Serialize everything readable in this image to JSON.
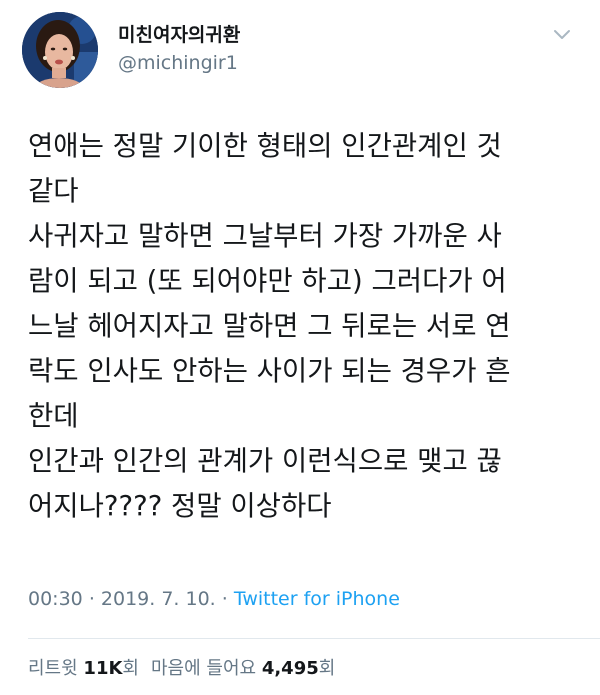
{
  "user": {
    "display_name": "미친여자의귀환",
    "handle": "@michingir1",
    "avatar_icon": "profile-photo"
  },
  "tweet": {
    "lines": [
      "연애는 정말 기이한 형태의 인간관계인 것",
      "같다",
      "사귀자고 말하면 그날부터 가장 가까운 사",
      "람이 되고 (또 되어야만 하고) 그러다가 어",
      "느날 헤어지자고 말하면 그 뒤로는 서로 연",
      "락도 인사도 안하는 사이가 되는 경우가 흔",
      "한데",
      "인간과 인간의 관계가 이런식으로 맺고 끊",
      "어지나???? 정말 이상하다"
    ]
  },
  "meta": {
    "time": "00:30",
    "separator": "·",
    "date": "2019. 7. 10.",
    "source": "Twitter for iPhone"
  },
  "stats": {
    "retweets_label": "리트윗",
    "retweets_count": "11K",
    "retweets_suffix": "회",
    "likes_label": "마음에 들어요",
    "likes_count": "4,495",
    "likes_suffix": "회"
  },
  "colors": {
    "text": "#14171a",
    "secondary": "#657786",
    "link": "#1da1f2",
    "divider": "#e1e8ed"
  },
  "icons": {
    "menu": "chevron-down-icon"
  }
}
